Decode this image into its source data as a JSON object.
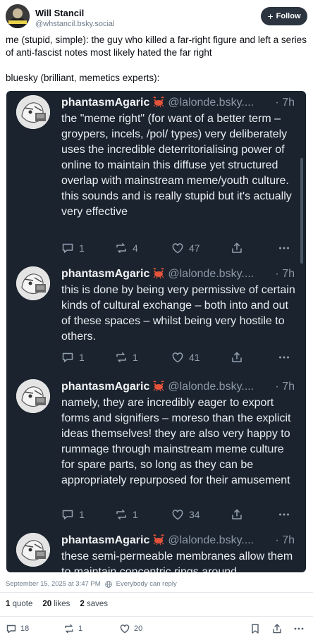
{
  "author": {
    "display_name": "Will Stancil",
    "handle": "@whstancil.bsky.social",
    "follow_label": "Follow",
    "avatar_icon": "profile-avatar"
  },
  "post": {
    "paragraph_1": "me (stupid, simple): the guy who killed a far-right figure and left a series of anti-fascist notes most likely hated the far right",
    "paragraph_2": "bluesky (brilliant, memetics experts):"
  },
  "embedded_replies": [
    {
      "name": "phantasmAgaric",
      "handle": "@lalonde.bsky....",
      "time": "· 7h",
      "text": "the \"meme right\" (for want of a better term – groypers, incels, /pol/ types) very deliberately uses the incredible deterritorialising power of online to maintain this diffuse yet structured overlap with mainstream meme/youth culture. this sounds and is really stupid but it's actually very effective",
      "replies": "1",
      "reposts": "4",
      "likes": "47"
    },
    {
      "name": "phantasmAgaric",
      "handle": "@lalonde.bsky....",
      "time": "· 7h",
      "text": "this is done by being very permissive of certain kinds of cultural exchange – both into and out of these spaces – whilst being very hostile to others.",
      "replies": "1",
      "reposts": "1",
      "likes": "41"
    },
    {
      "name": "phantasmAgaric",
      "handle": "@lalonde.bsky....",
      "time": "· 7h",
      "text": "namely, they are incredibly eager to export forms and signifiers – moreso than the explicit ideas themselves! they are also very happy to rummage through mainstream meme culture for spare parts, so long as they can be appropriately repurposed for their amusement",
      "replies": "1",
      "reposts": "1",
      "likes": "34"
    },
    {
      "name": "phantasmAgaric",
      "handle": "@lalonde.bsky....",
      "time": "· 7h",
      "text": "these semi-permeable membranes allow them to maintain concentric rings around"
    }
  ],
  "meta": {
    "timestamp": "September 15, 2025 at 3:47 PM",
    "reply_setting": "Everybody can reply"
  },
  "counts": {
    "quotes": "1",
    "quotes_label": "quote",
    "likes": "20",
    "likes_label": "likes",
    "saves": "2",
    "saves_label": "saves"
  },
  "actions": {
    "replies": "18",
    "reposts": "1",
    "likes": "20"
  },
  "colors": {
    "embed_bg": "#1b232e",
    "follow_bg": "#2c3440",
    "muted": "#6f7d8c"
  }
}
